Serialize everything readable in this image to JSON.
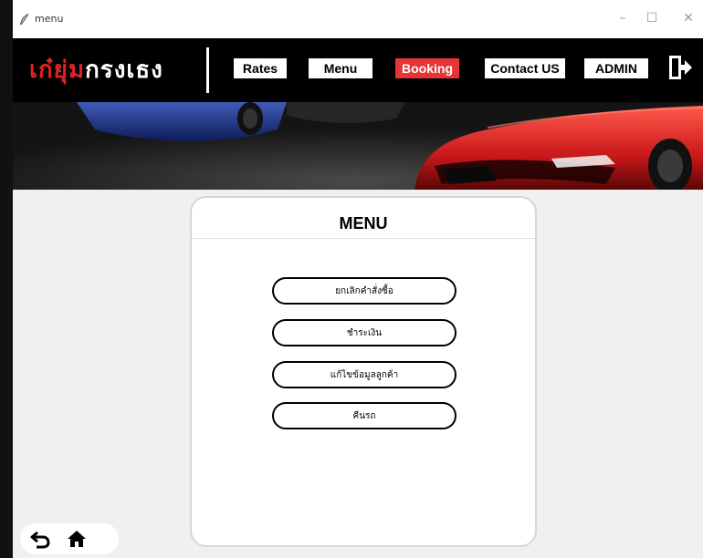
{
  "window": {
    "title": "menu",
    "minimize": "–",
    "maximize": "☐",
    "close": "✕"
  },
  "header": {
    "logo_red": "เก๋ยุ่ม",
    "logo_white": "กรงเธง",
    "nav": [
      "Rates",
      "Menu",
      "Booking",
      "Contact US",
      "ADMIN"
    ],
    "active_nav": "Booking",
    "accent_color": "#e53535"
  },
  "card": {
    "title": "MENU",
    "buttons": [
      "ยกเลิกคำสั่งซื้อ",
      "ชำระเงิน",
      "แก้ไขข้อมูลลูกค้า",
      "คืนรถ"
    ]
  },
  "icons": {
    "app": "feather-icon",
    "exit": "logout-icon",
    "back": "back-arrow-icon",
    "home": "home-icon"
  }
}
